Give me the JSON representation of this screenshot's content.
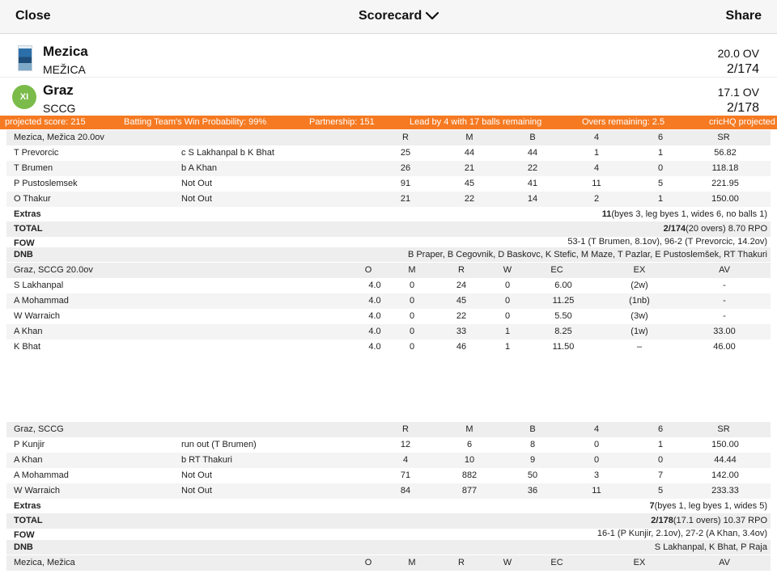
{
  "header": {
    "close": "Close",
    "title": "Scorecard",
    "share": "Share"
  },
  "teams": [
    {
      "name": "Mezica",
      "short": "MEŽICA",
      "overs": "20.0 OV",
      "score": "2/174"
    },
    {
      "name": "Graz",
      "short": "SCCG",
      "overs": "17.1 OV",
      "score": "2/178",
      "badge": "XI"
    }
  ],
  "ticker": [
    "projected score: 215",
    "Batting Team's Win Probability: 99%",
    "Partnership: 151",
    "Lead by 4 with 17 balls remaining",
    "Overs remaining: 2.5",
    "cricHQ projected"
  ],
  "innings1": {
    "title": "Mezica, Mežica 20.0ov",
    "cols": [
      "R",
      "M",
      "B",
      "4",
      "6",
      "SR"
    ],
    "batters": [
      {
        "name": "T Prevorcic",
        "how": "c S Lakhanpal b K Bhat",
        "r": "25",
        "m": "44",
        "b": "44",
        "f": "1",
        "s": "1",
        "sr": "56.82"
      },
      {
        "name": "T Brumen",
        "how": "b A Khan",
        "r": "26",
        "m": "21",
        "b": "22",
        "f": "4",
        "s": "0",
        "sr": "118.18"
      },
      {
        "name": "P Pustoslemsek",
        "how": "Not Out",
        "r": "91",
        "m": "45",
        "b": "41",
        "f": "11",
        "s": "5",
        "sr": "221.95"
      },
      {
        "name": "O Thakur",
        "how": "Not Out",
        "r": "21",
        "m": "22",
        "b": "14",
        "f": "2",
        "s": "1",
        "sr": "150.00"
      }
    ],
    "extras": {
      "label": "Extras",
      "value": "11",
      "detail": "(byes 3, leg byes 1, wides 6, no balls 1)"
    },
    "total": {
      "label": "TOTAL",
      "value": "2/174",
      "detail": "(20 overs) 8.70 RPO"
    },
    "fow": {
      "label": "FOW",
      "value": "53-1 (T Brumen, 8.1ov), 96-2 (T Prevorcic, 14.2ov)"
    },
    "dnb": {
      "label": "DNB",
      "value": "B Praper, B Cegovnik, D Baskovc, K Stefic, M Maze, T Pazlar, E Pustoslemšek, RT Thakuri"
    }
  },
  "bowling1": {
    "title": "Graz, SCCG 20.0ov",
    "cols": [
      "O",
      "M",
      "R",
      "W",
      "EC",
      "EX",
      "AV"
    ],
    "bowlers": [
      {
        "name": "S Lakhanpal",
        "o": "4.0",
        "m": "0",
        "r": "24",
        "w": "0",
        "ec": "6.00",
        "ex": "(2w)",
        "av": "-"
      },
      {
        "name": "A Mohammad",
        "o": "4.0",
        "m": "0",
        "r": "45",
        "w": "0",
        "ec": "11.25",
        "ex": "(1nb)",
        "av": "-"
      },
      {
        "name": "W Warraich",
        "o": "4.0",
        "m": "0",
        "r": "22",
        "w": "0",
        "ec": "5.50",
        "ex": "(3w)",
        "av": "-"
      },
      {
        "name": "A Khan",
        "o": "4.0",
        "m": "0",
        "r": "33",
        "w": "1",
        "ec": "8.25",
        "ex": "(1w)",
        "av": "33.00"
      },
      {
        "name": "K Bhat",
        "o": "4.0",
        "m": "0",
        "r": "46",
        "w": "1",
        "ec": "11.50",
        "ex": "–",
        "av": "46.00"
      }
    ]
  },
  "innings2": {
    "title": "Graz, SCCG",
    "cols": [
      "R",
      "M",
      "B",
      "4",
      "6",
      "SR"
    ],
    "batters": [
      {
        "name": "P Kunjir",
        "how": "run out (T Brumen)",
        "r": "12",
        "m": "6",
        "b": "8",
        "f": "0",
        "s": "1",
        "sr": "150.00"
      },
      {
        "name": "A Khan",
        "how": "b RT Thakuri",
        "r": "4",
        "m": "10",
        "b": "9",
        "f": "0",
        "s": "0",
        "sr": "44.44"
      },
      {
        "name": "A Mohammad",
        "how": "Not Out",
        "r": "71",
        "m": "882",
        "b": "50",
        "f": "3",
        "s": "7",
        "sr": "142.00"
      },
      {
        "name": "W Warraich",
        "how": "Not Out",
        "r": "84",
        "m": "877",
        "b": "36",
        "f": "11",
        "s": "5",
        "sr": "233.33"
      }
    ],
    "extras": {
      "label": "Extras",
      "value": "7",
      "detail": "(byes 1, leg byes 1, wides 5)"
    },
    "total": {
      "label": "TOTAL",
      "value": "2/178",
      "detail": "(17.1 overs) 10.37 RPO"
    },
    "fow": {
      "label": "FOW",
      "value": "16-1 (P Kunjir, 2.1ov), 27-2 (A Khan, 3.4ov)"
    },
    "dnb": {
      "label": "DNB",
      "value": "S Lakhanpal, K Bhat, P Raja"
    }
  },
  "bowling2": {
    "title": "Mezica, Mežica",
    "cols": [
      "O",
      "M",
      "R",
      "W",
      "EC",
      "EX",
      "AV"
    ]
  }
}
